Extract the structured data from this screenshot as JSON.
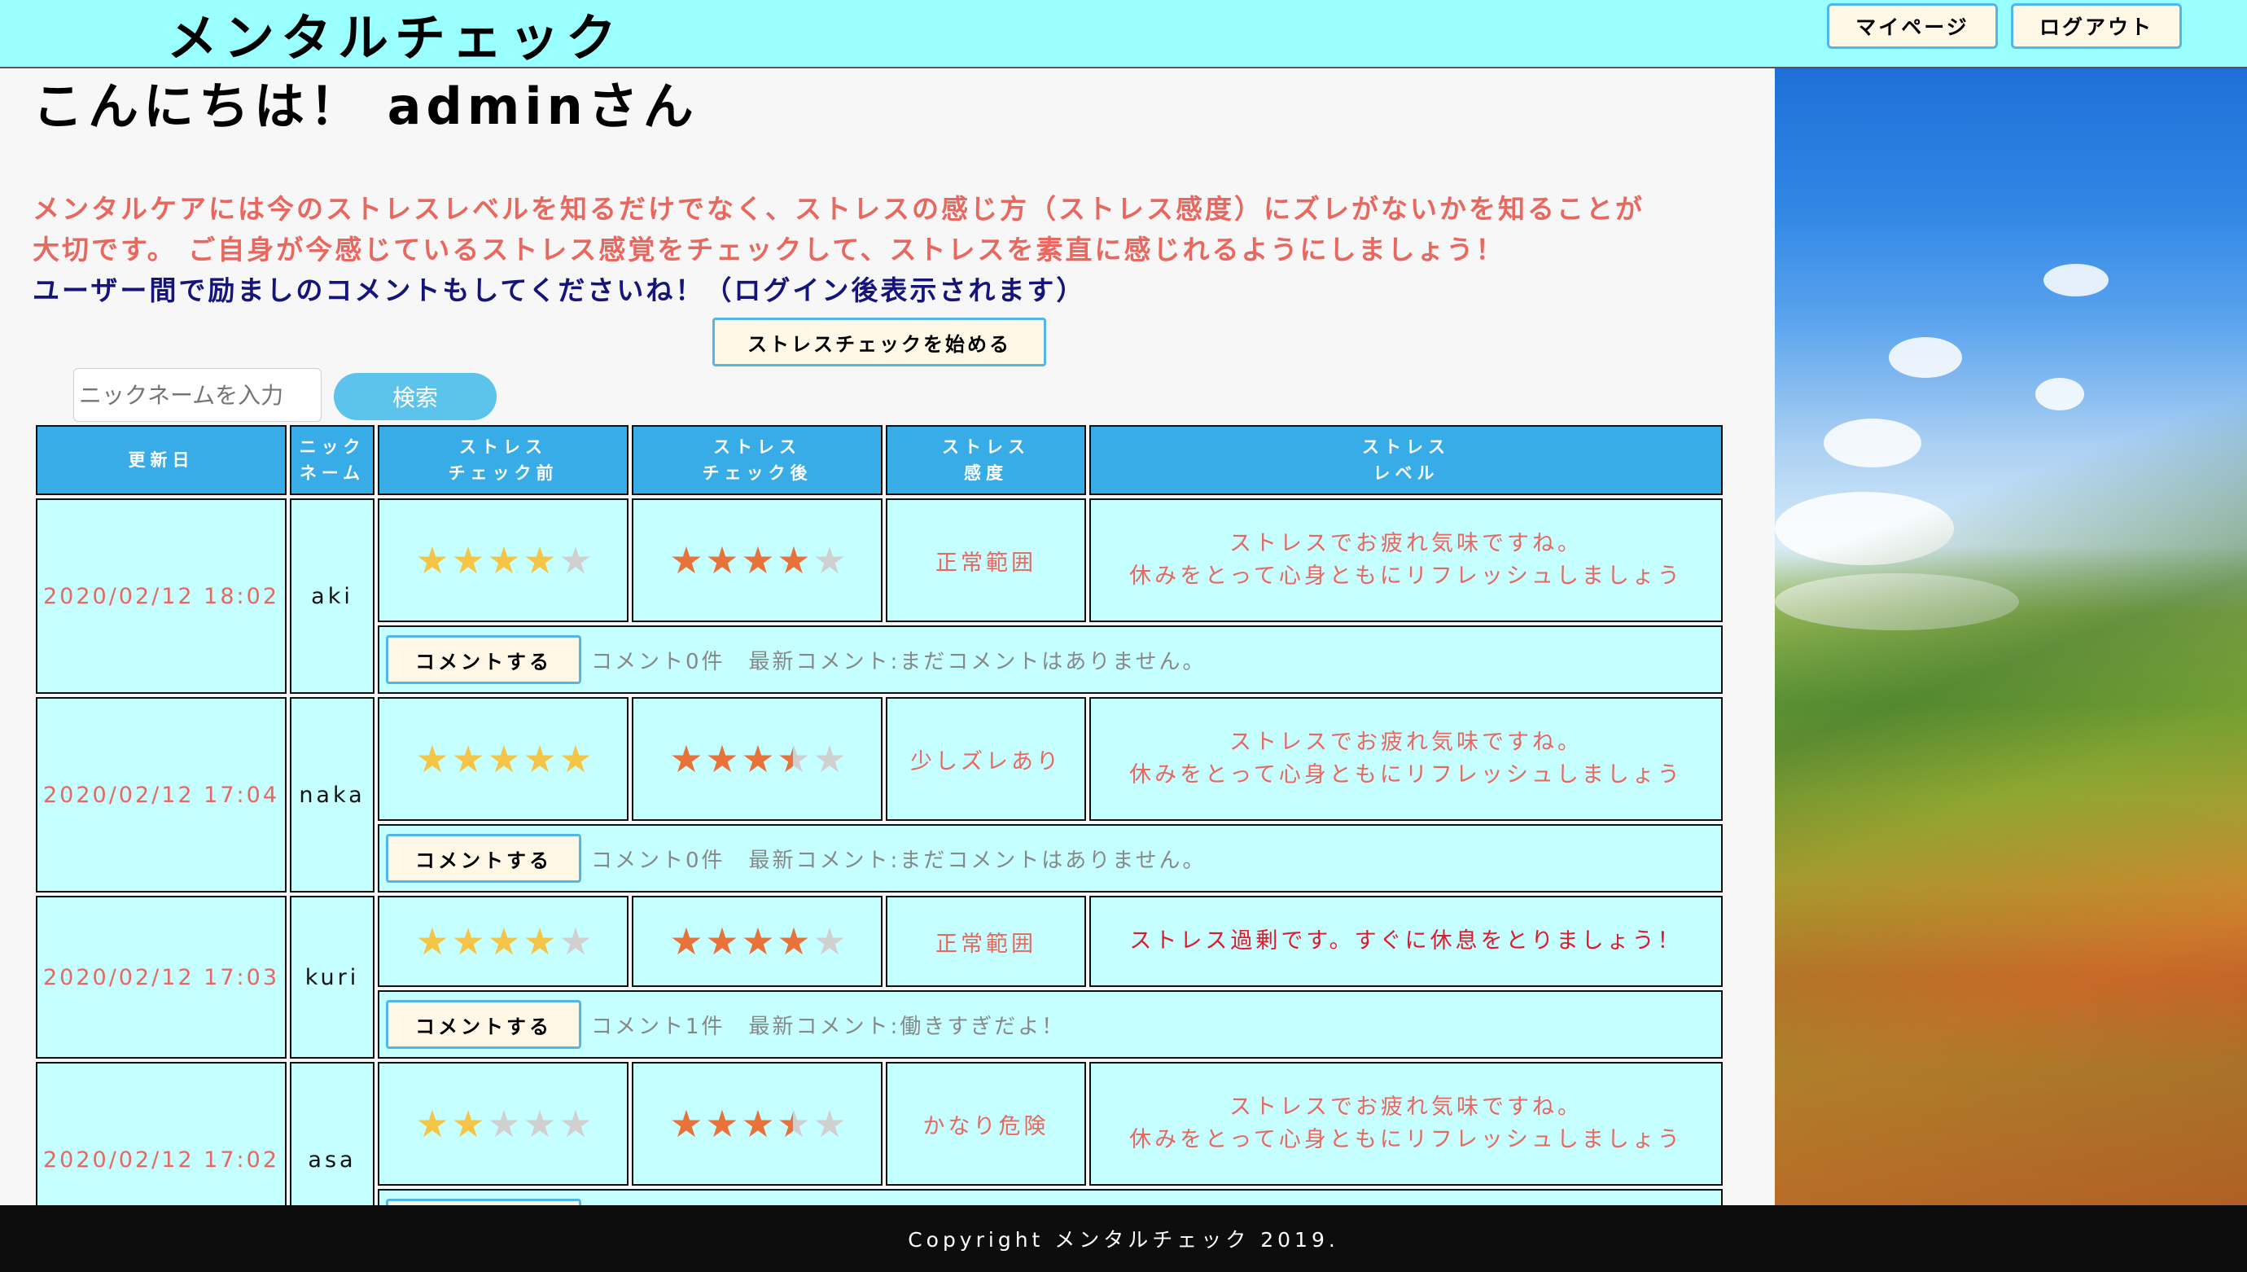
{
  "header": {
    "logo": "メンタルチェック",
    "mypage_label": "マイページ",
    "logout_label": "ログアウト"
  },
  "greeting": "こんにちは！ adminさん",
  "intro": {
    "line1": "メンタルケアには今のストレスレベルを知るだけでなく、ストレスの感じ方（ストレス感度）にズレがないかを知ることが",
    "line2": "大切です。 ご自身が今感じているストレス感覚をチェックして、ストレスを素直に感じれるようにしましょう！",
    "line3": "ユーザー間で励ましのコメントもしてくださいね！（ログイン後表示されます）"
  },
  "start_button": "ストレスチェックを始める",
  "search": {
    "placeholder": "ニックネームを入力",
    "button": "検索"
  },
  "table": {
    "headers": {
      "date": "更新日",
      "nick_1": "ニック",
      "nick_2": "ネーム",
      "before_1": "ストレス",
      "before_2": "チェック前",
      "after_1": "ストレス",
      "after_2": "チェック後",
      "sens_1": "ストレス",
      "sens_2": "感度",
      "level_1": "ストレス",
      "level_2": "レベル"
    },
    "comment_button": "コメントする",
    "rows": [
      {
        "date": "2020/02/12 18:02",
        "nickname": "aki",
        "before_stars": 4,
        "after_stars": 4,
        "sensitivity": "正常範囲",
        "level_1": "ストレスでお疲れ気味ですね。",
        "level_2": "休みをとって心身ともにリフレッシュしましょう",
        "comment": "コメント0件　最新コメント:まだコメントはありません。"
      },
      {
        "date": "2020/02/12 17:04",
        "nickname": "naka",
        "before_stars": 5,
        "after_stars": 3.5,
        "sensitivity": "少しズレあり",
        "level_1": "ストレスでお疲れ気味ですね。",
        "level_2": "休みをとって心身ともにリフレッシュしましょう",
        "comment": "コメント0件　最新コメント:まだコメントはありません。"
      },
      {
        "date": "2020/02/12 17:03",
        "nickname": "kuri",
        "before_stars": 4,
        "after_stars": 4,
        "sensitivity": "正常範囲",
        "level_1": "ストレス過剰です。すぐに休息をとりましょう！",
        "level_2": "",
        "comment": "コメント1件　最新コメント:働きすぎだよ！"
      },
      {
        "date": "2020/02/12 17:02",
        "nickname": "asa",
        "before_stars": 2,
        "after_stars": 3.5,
        "sensitivity": "かなり危険",
        "level_1": "ストレスでお疲れ気味ですね。",
        "level_2": "休みをとって心身ともにリフレッシュしましょう",
        "comment": ""
      }
    ]
  },
  "footer": "Copyright メンタルチェック 2019.",
  "colors": {
    "header_bg": "#99ffff",
    "table_header": "#37ace6",
    "cell_bg": "#c6ffff",
    "accent_text": "#e8675f",
    "danger_text": "#e0192a",
    "intro_blue": "#14147a",
    "star_before": "#f5c547",
    "star_after": "#e8733a"
  }
}
